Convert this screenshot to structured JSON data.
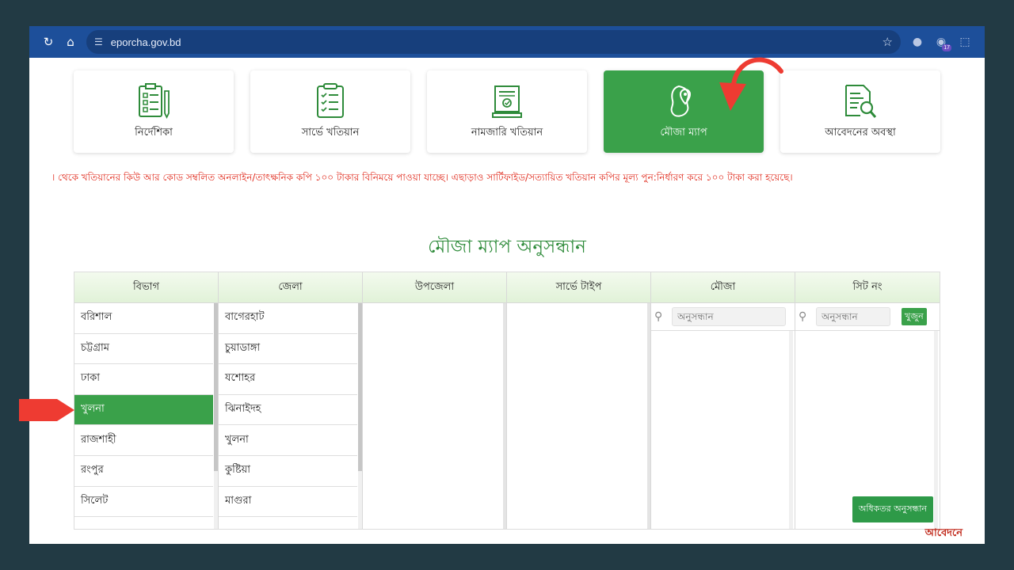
{
  "browser": {
    "url": "eporcha.gov.bd",
    "extension_badge": "17",
    "icons": [
      "reload-icon",
      "home-icon",
      "site-settings-icon",
      "star-icon",
      "mic-icon",
      "extensions-icon"
    ]
  },
  "cards": [
    {
      "label": "নির্দেশিকা",
      "icon": "clipboard-list-icon",
      "active": false
    },
    {
      "label": "সার্ভে খতিয়ান",
      "icon": "checklist-icon",
      "active": false
    },
    {
      "label": "নামজারি খতিয়ান",
      "icon": "document-stamp-icon",
      "active": false
    },
    {
      "label": "মৌজা ম্যাপ",
      "icon": "map-pin-icon",
      "active": true
    },
    {
      "label": "আবেদনের অবস্থা",
      "icon": "document-search-icon",
      "active": false
    }
  ],
  "notice": "। থেকে খতিয়ানের কিউ আর কোড সম্বলিত অনলাইন/তাৎক্ষনিক কপি ১০০ টাকার বিনিময়ে পাওয়া যাচ্ছে। এছাড়াও সার্টিফাইড/সত্যায়িত খতিয়ান কপির মূল্য পুন:নির্ধারণ করে ১০০ টাকা করা হয়েছে।",
  "heading": "মৌজা ম্যাপ অনুসন্ধান",
  "columns": {
    "division": "বিভাগ",
    "district": "জেলা",
    "upazila": "উপজেলা",
    "survey_type": "সার্ভে টাইপ",
    "mouza": "মৌজা",
    "sheet_no": "সিট নং"
  },
  "divisions": [
    "বরিশাল",
    "চট্টগ্রাম",
    "ঢাকা",
    "খুলনা",
    "রাজশাহী",
    "রংপুর",
    "সিলেট"
  ],
  "selected_division": "খুলনা",
  "districts": [
    "বাগেরহাট",
    "চুয়াডাঙ্গা",
    "যশোহর",
    "ঝিনাইদহ",
    "খুলনা",
    "কুষ্টিয়া",
    "মাগুরা"
  ],
  "search": {
    "mouza_placeholder": "অনুসন্ধান",
    "sheet_placeholder": "অনুসন্ধান",
    "find_button": "খুজুন",
    "advanced_button": "অধিকতর অনুসন্ধান"
  },
  "footer_link": "আবেদনে"
}
